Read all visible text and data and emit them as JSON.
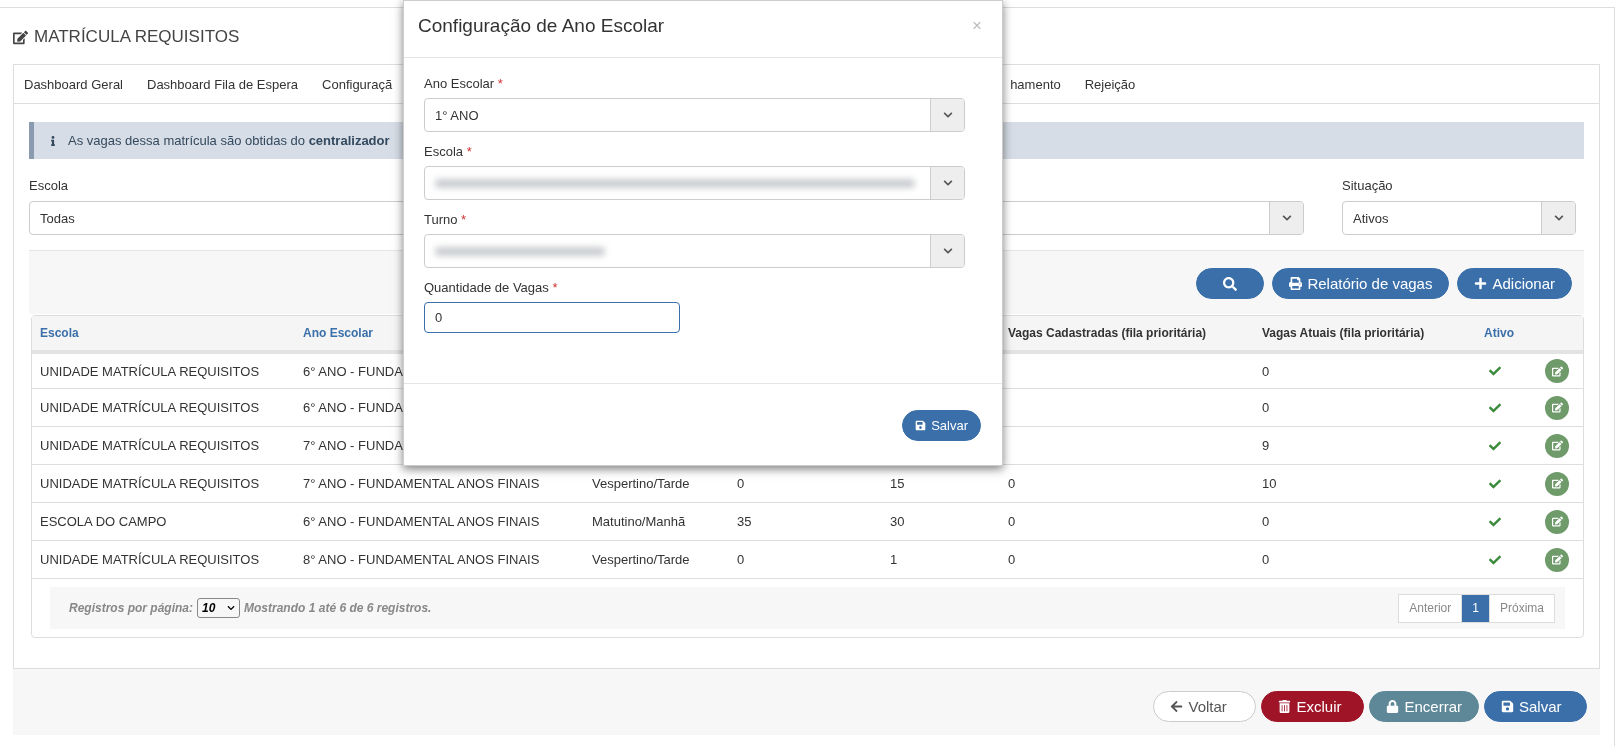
{
  "page": {
    "title": "MATRÍCULA REQUISITOS"
  },
  "tabs": [
    {
      "label": "Dashboard Geral",
      "selected": false
    },
    {
      "label": "Dashboard Fila de Espera",
      "selected": false
    },
    {
      "label": "Configuraçã",
      "selected": false
    },
    {
      "label": "hamento",
      "selected": false
    },
    {
      "label": "Rejeição",
      "selected": false
    }
  ],
  "info_banner": {
    "text": "As vagas dessa matrícula são obtidas do **centralizador**"
  },
  "filters": [
    {
      "kind": "select",
      "label": "Escola",
      "value": "Todas"
    },
    {
      "kind": "select",
      "caret_visible": true
    },
    {
      "kind": "select",
      "label": "Situação",
      "value": "Ativos",
      "caret_visible": true
    }
  ],
  "toolbar": [
    {
      "kind": "search"
    },
    {
      "kind": "print",
      "label": "Relatório de vagas"
    },
    {
      "kind": "add",
      "label": "Adicionar"
    }
  ],
  "table": {
    "columns": [
      {
        "kind": "escola",
        "label": "Escola",
        "link": true
      },
      {
        "kind": "ano_escolar",
        "label": "Ano Escolar",
        "link": true
      },
      {
        "kind": "vagas_cadastradas",
        "label": "Vagas Cadastradas (fila prioritária)",
        "link": false
      },
      {
        "kind": "vagas_atuais",
        "label": "Vagas Atuais (fila prioritária)",
        "link": false
      },
      {
        "kind": "ativo",
        "label": "Ativo",
        "link": true
      }
    ],
    "rows": [
      {
        "escola": "UNIDADE MATRÍCULA REQUISITOS",
        "ano_escolar": "6° ANO - FUNDA",
        "vagas_atuais": "0",
        "active": true
      },
      {
        "escola": "UNIDADE MATRÍCULA REQUISITOS",
        "ano_escolar": "6° ANO - FUNDA",
        "vagas_atuais": "0",
        "active": true
      },
      {
        "escola": "UNIDADE MATRÍCULA REQUISITOS",
        "ano_escolar": "7° ANO - FUNDA",
        "vagas_atuais": "9",
        "active": true
      },
      {
        "escola": "UNIDADE MATRÍCULA REQUISITOS",
        "ano_escolar": "7° ANO - FUNDAMENTAL ANOS FINAIS",
        "turno": "Vespertino/Tarde",
        "column_4": "0",
        "column_5": "15",
        "vagas_cadastradas": "0",
        "vagas_atuais": "10",
        "active": true
      },
      {
        "escola": "ESCOLA DO CAMPO",
        "ano_escolar": "6° ANO - FUNDAMENTAL ANOS FINAIS",
        "turno": "Matutino/Manhã",
        "column_4": "35",
        "column_5": "30",
        "vagas_cadastradas": "0",
        "vagas_atuais": "0",
        "active": true
      },
      {
        "escola": "UNIDADE MATRÍCULA REQUISITOS",
        "ano_escolar": "8° ANO - FUNDAMENTAL ANOS FINAIS",
        "turno": "Vespertino/Tarde",
        "column_4": "0",
        "column_5": "1",
        "vagas_cadastradas": "0",
        "vagas_atuais": "0",
        "active": true
      }
    ]
  },
  "pagination": {
    "per_page_label": "Registros por página:",
    "per_page": "10",
    "summary": "Mostrando **1** até **6** de **6** registros.",
    "pages": [
      {
        "label": "Anterior",
        "selected": false,
        "disabled": true
      },
      {
        "label": "1",
        "selected": true,
        "disabled": false
      },
      {
        "label": "Próxima",
        "selected": false,
        "disabled": true
      }
    ]
  },
  "footer_buttons": [
    {
      "kind": "back",
      "label": "Voltar"
    },
    {
      "kind": "delete",
      "label": "Excluir"
    },
    {
      "kind": "lock",
      "label": "Encerrar"
    },
    {
      "kind": "save",
      "label": "Salvar"
    }
  ],
  "modal": {
    "title": "Configuração de Ano Escolar",
    "close": "×",
    "fields": [
      {
        "kind": "select",
        "label": "Ano Escolar",
        "required_mark": "*",
        "value": "1° ANO"
      },
      {
        "kind": "select",
        "label": "Escola",
        "required_mark": "*",
        "redacted": true
      },
      {
        "kind": "select",
        "label": "Turno",
        "required_mark": "*",
        "redacted": true
      },
      {
        "kind": "input",
        "label": "Quantidade de Vagas",
        "required_mark": "*",
        "value": "0"
      }
    ],
    "save_button": "Salvar"
  }
}
